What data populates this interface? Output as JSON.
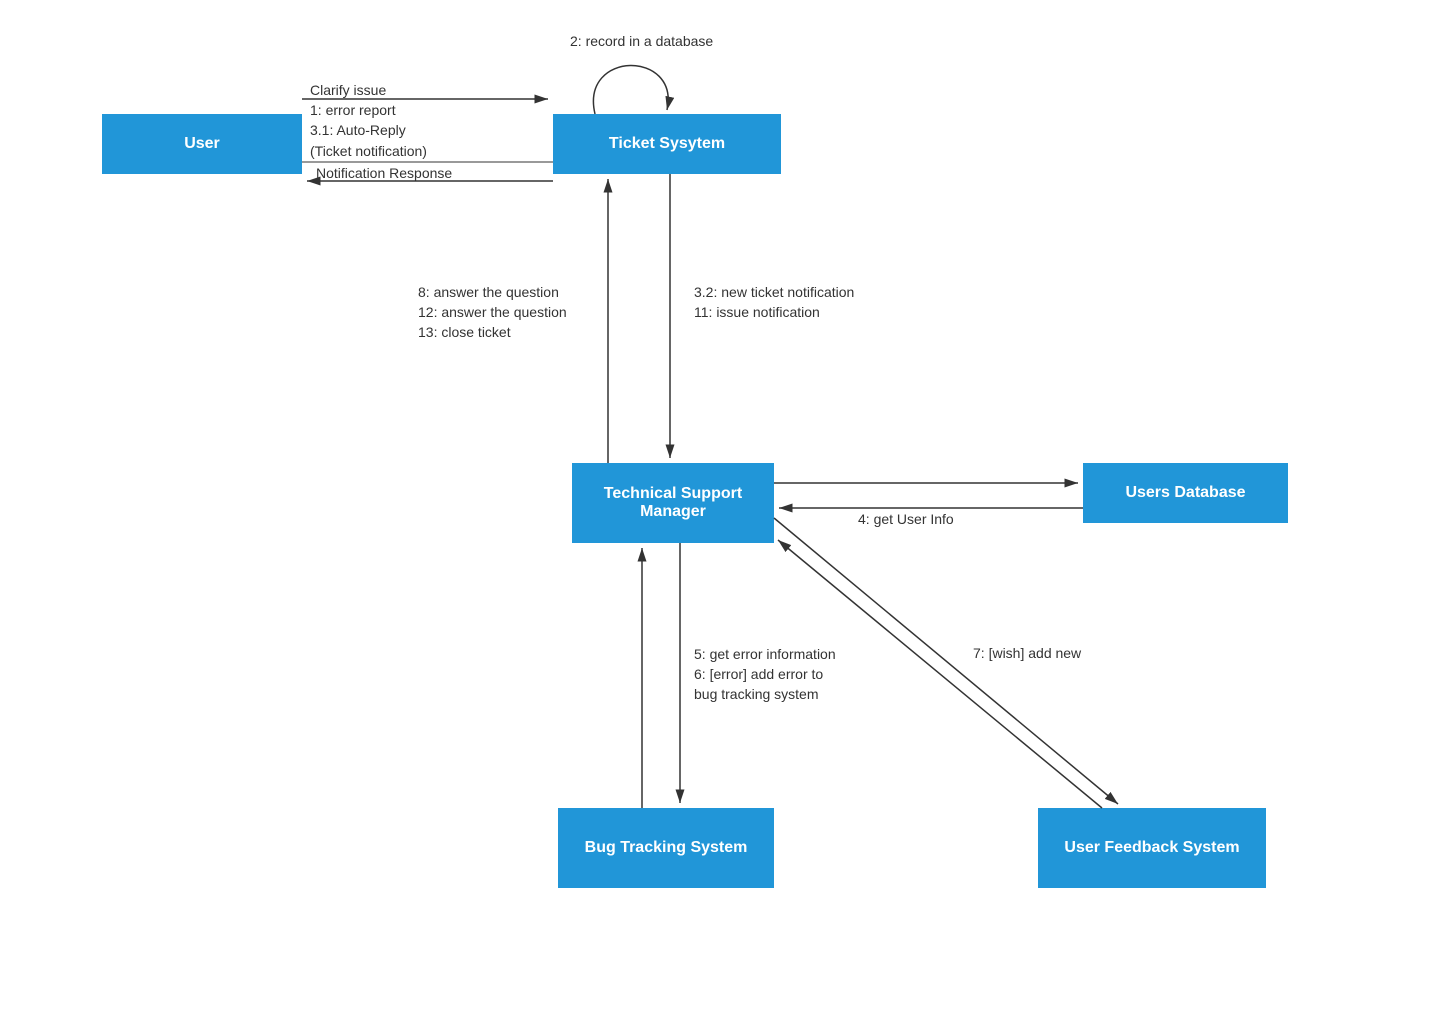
{
  "nodes": {
    "user": "User",
    "ticket_system": "Ticket Sysytem",
    "tech_support": "Technical Support Manager",
    "users_db": "Users Database",
    "bug_tracking": "Bug Tracking System",
    "user_feedback": "User Feedback System"
  },
  "edges": {
    "clarify": "Clarify issue",
    "error_report": "1: error report",
    "auto_reply_1": "3.1: Auto-Reply",
    "auto_reply_2": "(Ticket notification)",
    "notification_response": "Notification Response",
    "record_db": "2: record in a database",
    "answer_8": "8: answer the question",
    "answer_12": "12: answer the question",
    "close_13": "13: close ticket",
    "new_ticket": "3.2: new ticket notification",
    "issue_notif": "11: issue notification",
    "get_user_info": "4: get User Info",
    "get_error_1": "5: get error information",
    "get_error_2": "6: [error] add error to",
    "get_error_3": "bug tracking system",
    "wish_add": "7: [wish] add new"
  }
}
